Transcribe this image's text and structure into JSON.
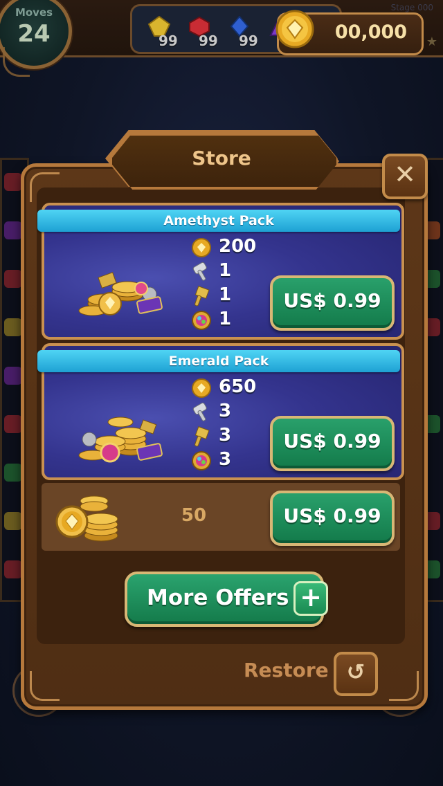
{
  "hud": {
    "moves_label": "Moves",
    "moves_value": "24",
    "goals": [
      {
        "gem": "yellow-gem-icon",
        "count": "99",
        "color": "#e3c43a"
      },
      {
        "gem": "red-gem-icon",
        "count": "99",
        "color": "#d2363a"
      },
      {
        "gem": "blue-gem-icon",
        "count": "99",
        "color": "#3a6fd8"
      },
      {
        "gem": "purple-gem-icon",
        "count": "",
        "color": "#8a3ad2"
      }
    ],
    "coins": "00,000",
    "stage": "Stage 000"
  },
  "store": {
    "title": "Store",
    "close_icon": "close-icon",
    "packs": [
      {
        "name": "Amethyst Pack",
        "rewards": [
          {
            "icon": "coin-icon",
            "value": "200"
          },
          {
            "icon": "hammer-icon",
            "value": "1"
          },
          {
            "icon": "gold-hammer-icon",
            "value": "1"
          },
          {
            "icon": "rainbow-gem-icon",
            "value": "1"
          }
        ],
        "price": "US$ 0.99"
      },
      {
        "name": "Emerald Pack",
        "rewards": [
          {
            "icon": "coin-icon",
            "value": "650"
          },
          {
            "icon": "hammer-icon",
            "value": "3"
          },
          {
            "icon": "gold-hammer-icon",
            "value": "3"
          },
          {
            "icon": "rainbow-gem-icon",
            "value": "3"
          }
        ],
        "price": "US$ 0.99"
      }
    ],
    "coin_offer": {
      "value": "50",
      "price": "US$ 0.99"
    },
    "more_offers": "More Offers",
    "restore": "Restore"
  },
  "colors": {
    "panel": "#5d3718",
    "border_gold": "#b6793c",
    "ribbon_blue": "#1ea1d3",
    "button_green": "#1b8a56",
    "pack_purple": "#34348e"
  }
}
